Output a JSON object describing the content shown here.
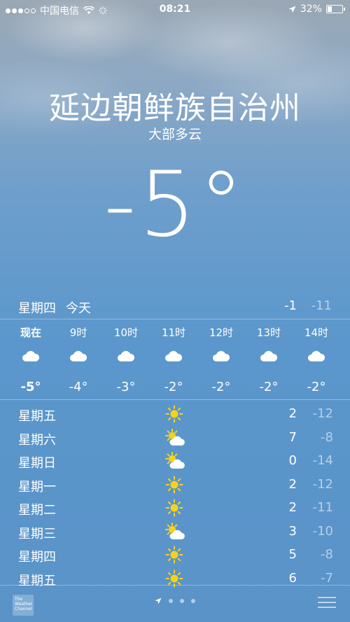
{
  "status_bar": {
    "carrier": "中国电信",
    "time": "08:21",
    "battery_percent": "32%",
    "battery_level": 0.32,
    "signal_filled": 3,
    "signal_total": 5
  },
  "location": {
    "city": "延边朝鲜族自治州",
    "condition": "大部多云",
    "temperature": "-5°"
  },
  "today": {
    "day": "星期四",
    "label": "今天",
    "high": "-1",
    "low": "-11"
  },
  "hourly": [
    {
      "time": "现在",
      "icon": "cloud-icon",
      "temp": "-5°"
    },
    {
      "time": "9时",
      "icon": "cloud-icon",
      "temp": "-4°"
    },
    {
      "time": "10时",
      "icon": "cloud-icon",
      "temp": "-3°"
    },
    {
      "time": "11时",
      "icon": "cloud-icon",
      "temp": "-2°"
    },
    {
      "time": "12时",
      "icon": "cloud-icon",
      "temp": "-2°"
    },
    {
      "time": "13时",
      "icon": "cloud-icon",
      "temp": "-2°"
    },
    {
      "time": "14时",
      "icon": "cloud-icon",
      "temp": "-2°"
    }
  ],
  "daily": [
    {
      "day": "星期五",
      "icon": "sun-icon",
      "high": "2",
      "low": "-12"
    },
    {
      "day": "星期六",
      "icon": "partly-cloudy-icon",
      "high": "7",
      "low": "-8"
    },
    {
      "day": "星期日",
      "icon": "partly-cloudy-icon",
      "high": "0",
      "low": "-14"
    },
    {
      "day": "星期一",
      "icon": "sun-icon",
      "high": "2",
      "low": "-12"
    },
    {
      "day": "星期二",
      "icon": "sun-icon",
      "high": "2",
      "low": "-11"
    },
    {
      "day": "星期三",
      "icon": "partly-cloudy-icon",
      "high": "3",
      "low": "-10"
    },
    {
      "day": "星期四",
      "icon": "sun-icon",
      "high": "5",
      "low": "-8"
    },
    {
      "day": "星期五",
      "icon": "sun-icon",
      "high": "6",
      "low": "-7"
    }
  ],
  "footer": {
    "provider_logo": "The Weather Channel",
    "pages": 4
  }
}
